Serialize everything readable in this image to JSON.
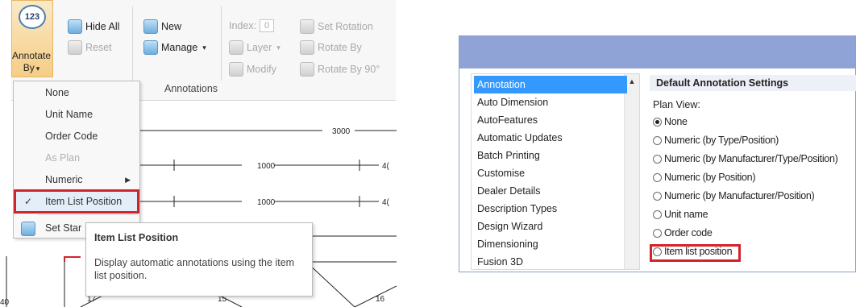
{
  "ribbon": {
    "annotate_by_label": "Annotate By",
    "big_icon_text": "123",
    "hide_all": "Hide All",
    "reset": "Reset",
    "new": "New",
    "manage": "Manage",
    "index_label": "Index:",
    "index_value": "0",
    "set_rotation": "Set Rotation",
    "layer": "Layer",
    "rotate_by": "Rotate By",
    "modify": "Modify",
    "rotate_by_90": "Rotate By 90°",
    "group_label": "Annotations"
  },
  "menu": {
    "items": [
      {
        "label": "None"
      },
      {
        "label": "Unit Name"
      },
      {
        "label": "Order Code"
      },
      {
        "label": "As Plan"
      },
      {
        "label": "Numeric"
      },
      {
        "label": "Item List Position"
      },
      {
        "label": "Set Star"
      }
    ]
  },
  "tooltip": {
    "title": "Item List Position",
    "description": "Display automatic annotations using the item list position."
  },
  "drawing": {
    "dim_3000": "3000",
    "dim_1000_a": "1000",
    "dim_1000_b": "1000",
    "dim_4_a": "4(",
    "dim_4_b": "4(",
    "num_17": "17",
    "num_15": "15",
    "num_16": "16",
    "num_40": "40"
  },
  "settings": {
    "categories": [
      {
        "label": "Annotation"
      },
      {
        "label": "Auto Dimension"
      },
      {
        "label": "AutoFeatures"
      },
      {
        "label": "Automatic Updates"
      },
      {
        "label": "Batch Printing"
      },
      {
        "label": "Customise"
      },
      {
        "label": "Dealer Details"
      },
      {
        "label": "Description Types"
      },
      {
        "label": "Design Wizard"
      },
      {
        "label": "Dimensioning"
      },
      {
        "label": "Fusion 3D"
      }
    ],
    "header": "Default Annotation Settings",
    "plan_view_label": "Plan View:",
    "options": [
      {
        "label": "None"
      },
      {
        "label": "Numeric (by Type/Position)"
      },
      {
        "label": "Numeric (by Manufacturer/Type/Position)"
      },
      {
        "label": "Numeric (by Position)"
      },
      {
        "label": "Numeric (by Manufacturer/Position)"
      },
      {
        "label": "Unit name"
      },
      {
        "label": "Order code"
      },
      {
        "label": "Item list position"
      }
    ],
    "selected_option": "None"
  },
  "colors": {
    "highlight_red": "#d2232a",
    "selection_blue": "#3399ff",
    "title_bar": "#8fa3d6"
  }
}
